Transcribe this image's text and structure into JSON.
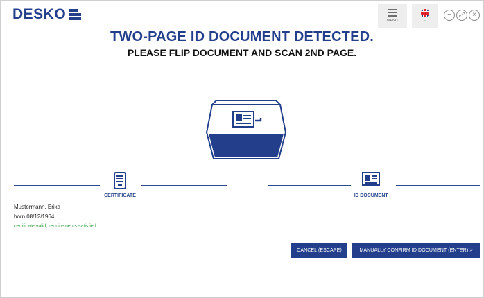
{
  "header": {
    "logo_text": "DESKO",
    "menu_label": "MENU",
    "language_icon": "uk-flag-icon",
    "window_controls": [
      "minimize-icon",
      "expand-icon",
      "close-icon"
    ]
  },
  "message": {
    "title": "TWO-PAGE ID DOCUMENT DETECTED.",
    "subtitle": "PLEASE FLIP DOCUMENT AND SCAN 2ND PAGE."
  },
  "steps": {
    "certificate_label": "CERTIFICATE",
    "id_document_label": "ID DOCUMENT"
  },
  "holder": {
    "name": "Mustermann, Erika",
    "born": "born 08/12/1964",
    "status": "certificate valid, requirements satisfied"
  },
  "actions": {
    "cancel_label": "CANCEL (ESCAPE)",
    "confirm_label": "MANUALLY CONFIRM ID DOCUMENT (ENTER) >"
  },
  "colors": {
    "brand_blue": "#233f8c",
    "status_green": "#2f9e3f"
  }
}
